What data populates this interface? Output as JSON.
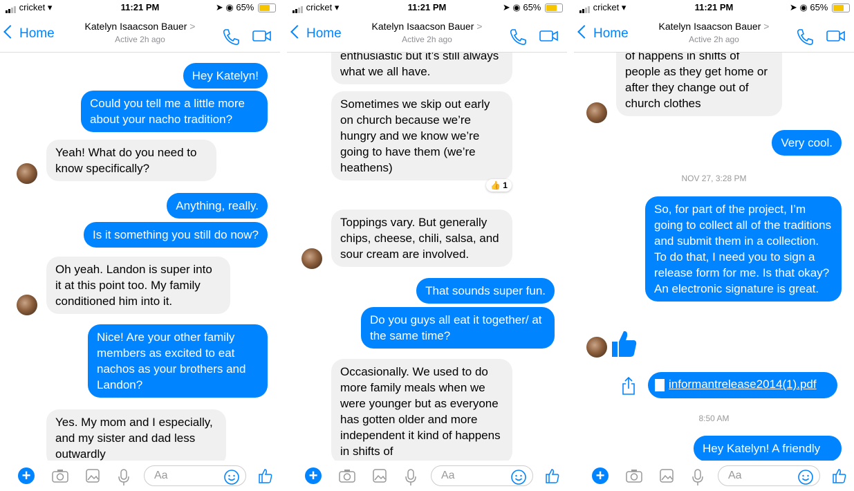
{
  "status": {
    "carrier": "cricket",
    "time": "11:21 PM",
    "battery": "65%",
    "battery_level": 0.65
  },
  "header": {
    "back_label": "Home",
    "contact_name": "Katelyn Isaacson Bauer",
    "chevron": ">",
    "active": "Active 2h ago"
  },
  "composer": {
    "placeholder": "Aa"
  },
  "colors": {
    "accent": "#0084ff",
    "incoming_bubble": "#f1f0f0",
    "battery": "#f6c500"
  },
  "icons": [
    "chevron-left-icon",
    "phone-icon",
    "video-icon",
    "plus-icon",
    "camera-icon",
    "image-icon",
    "microphone-icon",
    "smiley-icon",
    "thumbs-up-icon",
    "share-icon",
    "document-icon"
  ],
  "panels": [
    {
      "messages": [
        {
          "from": "me",
          "text": "Hey Katelyn!"
        },
        {
          "from": "me",
          "text": "Could you tell me a little more about your nacho tradition?"
        },
        {
          "from": "them",
          "text": "Yeah! What do you need to know specifically?"
        },
        {
          "from": "me",
          "text": "Anything, really."
        },
        {
          "from": "me",
          "text": "Is it something you still do now?"
        },
        {
          "from": "them",
          "text": "Oh yeah. Landon is super into it at this point too. My family conditioned him into it."
        },
        {
          "from": "me",
          "text": "Nice! Are your other family members as excited to eat nachos as your brothers and Landon?"
        },
        {
          "from": "them",
          "text": "Yes. My mom and I especially, and my sister and dad less outwardly"
        }
      ]
    },
    {
      "messages": [
        {
          "from": "them",
          "text": "enthusiastic but it’s still always what we all have."
        },
        {
          "from": "them",
          "text": "Sometimes we skip out early on church because we’re hungry and we know we’re going to have them (we’re heathens)"
        },
        {
          "from": "them",
          "text": "Toppings vary. But generally chips, cheese, chili, salsa, and sour cream are involved."
        },
        {
          "from": "me",
          "text": "That sounds super fun."
        },
        {
          "from": "me",
          "text": "Do you guys all eat it together/ at the same time?"
        },
        {
          "from": "them",
          "text": "Occasionally. We used to do more family meals when we were younger but as everyone has gotten older and more independent it kind of happens in shifts of"
        }
      ],
      "reaction": {
        "emoji": "👍",
        "count": "1"
      }
    },
    {
      "messages": [
        {
          "from": "them",
          "text": "of happens in shifts of people as they get home or after they change out of church clothes"
        },
        {
          "from": "me",
          "text": "Very cool."
        },
        {
          "from": "me",
          "text": "So, for part of the project, I’m going to collect all of the traditions and submit them in a collection. To do that, I need you to sign a release form for me. Is that okay? An electronic signature is great."
        },
        {
          "from": "me",
          "text": "Hey Katelyn! A friendly"
        }
      ],
      "timestamps": [
        "NOV 27, 3:28 PM",
        "8:50 AM"
      ],
      "attachment": "informantrelease2014(1).pdf"
    }
  ]
}
